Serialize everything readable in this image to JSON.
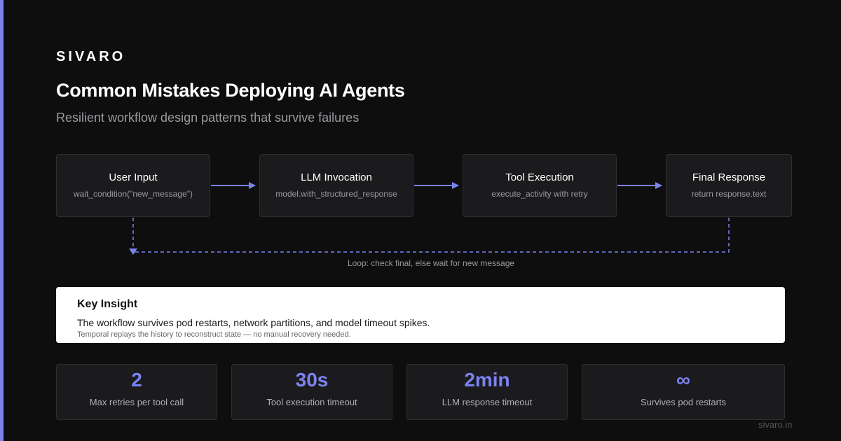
{
  "brand": "SIVARO",
  "title": "Common Mistakes Deploying AI Agents",
  "subtitle": "Resilient workflow design patterns that survive failures",
  "steps": [
    {
      "title": "User Input",
      "detail": "wait_condition(\"new_message\")"
    },
    {
      "title": "LLM Invocation",
      "detail": "model.with_structured_response"
    },
    {
      "title": "Tool Execution",
      "detail": "execute_activity with retry"
    },
    {
      "title": "Final Response",
      "detail": "return response.text"
    }
  ],
  "loop_label": "Loop: check final, else wait for new message",
  "insight": {
    "title": "Key Insight",
    "body": "The workflow survives pod restarts, network partitions, and model timeout spikes.",
    "note": "Temporal replays the history to reconstruct state — no manual recovery needed."
  },
  "stats": [
    {
      "value": "2",
      "label": "Max retries per tool call"
    },
    {
      "value": "30s",
      "label": "Tool execution timeout"
    },
    {
      "value": "2min",
      "label": "LLM response timeout"
    },
    {
      "value": "∞",
      "label": "Survives pod restarts"
    }
  ],
  "footer": "sivaro.in",
  "colors": {
    "accent": "#7b83f0",
    "background": "#0e0e0f",
    "card": "#1b1b1d",
    "insight_bg": "#ffffff"
  }
}
